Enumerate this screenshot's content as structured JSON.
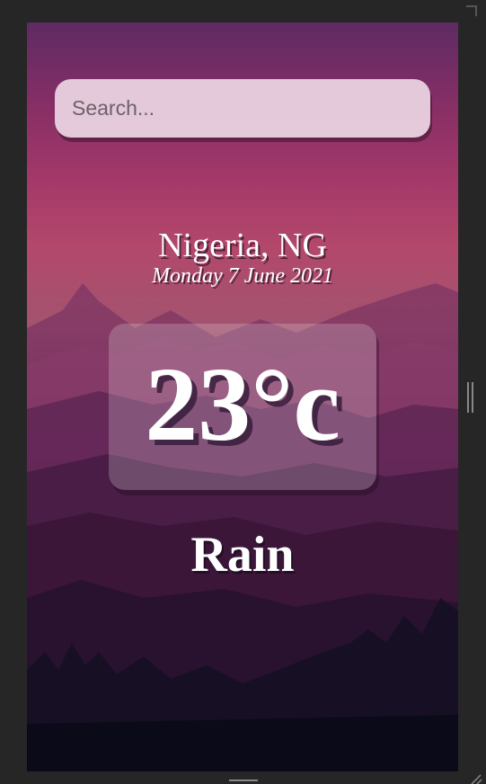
{
  "search": {
    "placeholder": "Search..."
  },
  "location": {
    "name": "Nigeria, NG",
    "date": "Monday 7 June 2021"
  },
  "weather": {
    "temperature": "23°c",
    "condition": "Rain"
  },
  "colors": {
    "sky_top": "#5e2a63",
    "sky_mid": "#a63a69",
    "ground": "#0d0b1c",
    "text": "#ffffff"
  }
}
